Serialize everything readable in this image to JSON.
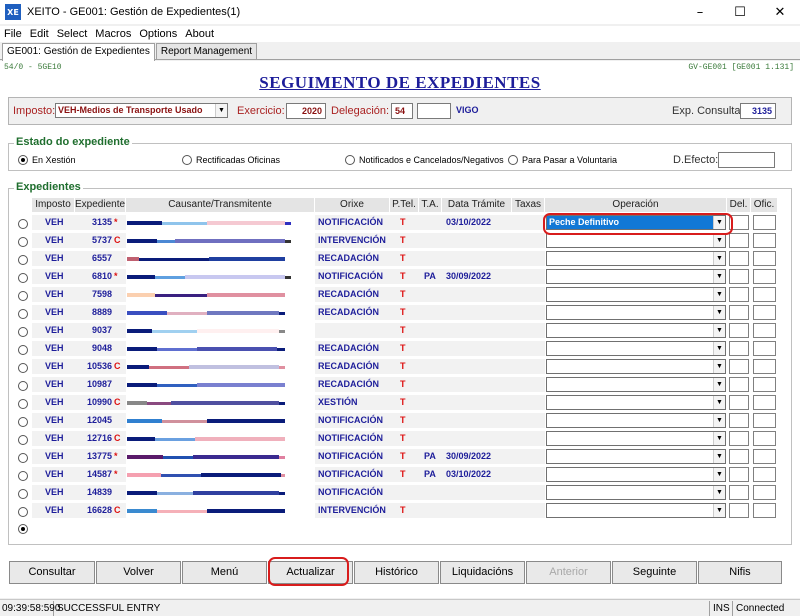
{
  "window": {
    "title": "XEITO - GE001: Gestión de Expedientes(1)",
    "icon_text": "XE"
  },
  "menu": [
    "File",
    "Edit",
    "Select",
    "Macros",
    "Options",
    "About"
  ],
  "tabs": [
    {
      "label": "GE001: Gestión de Expedientes"
    },
    {
      "label": "Report Management"
    }
  ],
  "header": {
    "left_code": "54/0 - 5GE10",
    "right_code": "GV-GE001 [GE001 1.131]",
    "title": "SEGUIMENTO DE EXPEDIENTES"
  },
  "filters": {
    "imposto_label": "Imposto:",
    "imposto_value": "VEH-Medios de Transporte Usado",
    "exercicio_label": "Exercicio:",
    "exercicio_value": "2020",
    "delegacion_label": "Delegación:",
    "delegacion_code": "54",
    "delegacion_name": "VIGO",
    "exp_consulta_label": "Exp. Consulta:",
    "exp_consulta_value": "3135"
  },
  "estado": {
    "title": "Estado do expediente",
    "options": [
      "En Xestión",
      "Rectificadas Oficinas",
      "Notificados e Cancelados/Negativos",
      "Para Pasar a Voluntaria"
    ],
    "selected": 0,
    "defecto_label": "D.Efecto:",
    "defecto_value": ""
  },
  "expedientes": {
    "title": "Expedientes",
    "columns": [
      "Imposto",
      "Expediente",
      "Causante/Transmitente",
      "Orixe",
      "P.Tel.",
      "T.A.",
      "Data Trámite",
      "Taxas",
      "Operación",
      "Del.",
      "Ofic."
    ],
    "rows": [
      {
        "imposto": "VEH",
        "expediente": "3135",
        "flag": "*",
        "orixe": "NOTIFICACIÓN",
        "ptel": "T",
        "ta": "",
        "data": "03/10/2022",
        "operacion": "Peche Definitivo"
      },
      {
        "imposto": "VEH",
        "expediente": "5737",
        "flag": "C",
        "orixe": "INTERVENCIÓN",
        "ptel": "T",
        "ta": "",
        "data": "",
        "operacion": ""
      },
      {
        "imposto": "VEH",
        "expediente": "6557",
        "flag": "",
        "orixe": "RECADACIÓN",
        "ptel": "T",
        "ta": "",
        "data": "",
        "operacion": ""
      },
      {
        "imposto": "VEH",
        "expediente": "6810",
        "flag": "*",
        "orixe": "NOTIFICACIÓN",
        "ptel": "T",
        "ta": "PA",
        "data": "30/09/2022",
        "operacion": ""
      },
      {
        "imposto": "VEH",
        "expediente": "7598",
        "flag": "",
        "orixe": "RECADACIÓN",
        "ptel": "T",
        "ta": "",
        "data": "",
        "operacion": ""
      },
      {
        "imposto": "VEH",
        "expediente": "8889",
        "flag": "",
        "orixe": "RECADACIÓN",
        "ptel": "T",
        "ta": "",
        "data": "",
        "operacion": ""
      },
      {
        "imposto": "VEH",
        "expediente": "9037",
        "flag": "",
        "orixe": "",
        "ptel": "T",
        "ta": "",
        "data": "",
        "operacion": ""
      },
      {
        "imposto": "VEH",
        "expediente": "9048",
        "flag": "",
        "orixe": "RECADACIÓN",
        "ptel": "T",
        "ta": "",
        "data": "",
        "operacion": ""
      },
      {
        "imposto": "VEH",
        "expediente": "10536",
        "flag": "C",
        "orixe": "RECADACIÓN",
        "ptel": "T",
        "ta": "",
        "data": "",
        "operacion": ""
      },
      {
        "imposto": "VEH",
        "expediente": "10987",
        "flag": "",
        "orixe": "RECADACIÓN",
        "ptel": "T",
        "ta": "",
        "data": "",
        "operacion": ""
      },
      {
        "imposto": "VEH",
        "expediente": "10990",
        "flag": "C",
        "orixe": "XESTIÓN",
        "ptel": "T",
        "ta": "",
        "data": "",
        "operacion": ""
      },
      {
        "imposto": "VEH",
        "expediente": "12045",
        "flag": "",
        "orixe": "NOTIFICACIÓN",
        "ptel": "T",
        "ta": "",
        "data": "",
        "operacion": ""
      },
      {
        "imposto": "VEH",
        "expediente": "12716",
        "flag": "C",
        "orixe": "NOTIFICACIÓN",
        "ptel": "T",
        "ta": "",
        "data": "",
        "operacion": ""
      },
      {
        "imposto": "VEH",
        "expediente": "13775",
        "flag": "*",
        "orixe": "NOTIFICACIÓN",
        "ptel": "T",
        "ta": "PA",
        "data": "30/09/2022",
        "operacion": ""
      },
      {
        "imposto": "VEH",
        "expediente": "14587",
        "flag": "*",
        "orixe": "NOTIFICACIÓN",
        "ptel": "T",
        "ta": "PA",
        "data": "03/10/2022",
        "operacion": ""
      },
      {
        "imposto": "VEH",
        "expediente": "14839",
        "flag": "",
        "orixe": "NOTIFICACIÓN",
        "ptel": "",
        "ta": "",
        "data": "",
        "operacion": ""
      },
      {
        "imposto": "VEH",
        "expediente": "16628",
        "flag": "C",
        "orixe": "INTERVENCIÓN",
        "ptel": "T",
        "ta": "",
        "data": "",
        "operacion": ""
      }
    ]
  },
  "buttons": [
    "Consultar",
    "Volver",
    "Menú",
    "Actualizar",
    "Histórico",
    "Liquidacións",
    "Anterior",
    "Seguinte",
    "Nifis"
  ],
  "status": {
    "time": "09:39:58:590",
    "message": "SUCCESSFUL ENTRY",
    "mode": "INS",
    "connection": "Connected"
  },
  "colors": {
    "title_blue": "#1d1d9a",
    "orixe_blue": "#1d1d9a",
    "flag_red": "#d11",
    "group_green": "#1f6e2e",
    "selection_blue": "#1178d6",
    "highlight_red": "#d81c1c"
  }
}
